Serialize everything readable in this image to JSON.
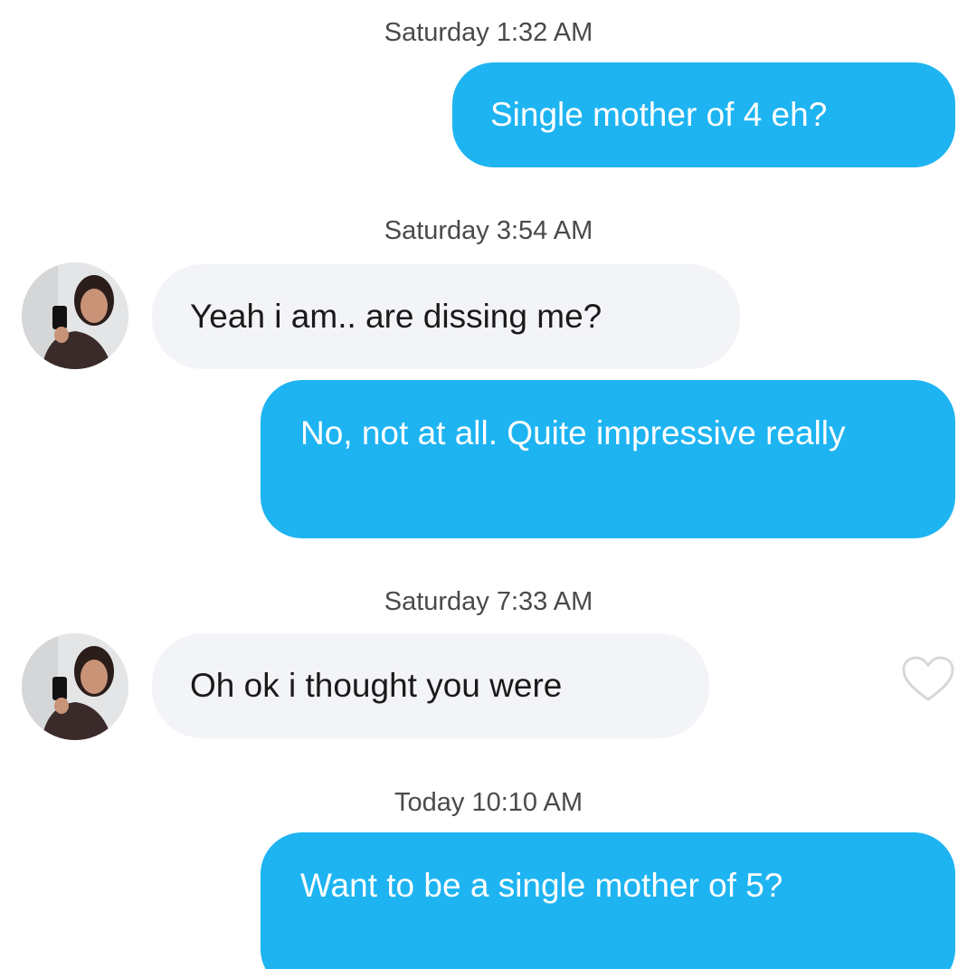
{
  "conversation": {
    "messages": [
      {
        "type": "timestamp",
        "text": "Saturday 1:32 AM"
      },
      {
        "type": "sent",
        "text": "Single mother of 4 eh?"
      },
      {
        "type": "timestamp",
        "text": "Saturday 3:54 AM"
      },
      {
        "type": "received",
        "text": "Yeah i am.. are dissing me?"
      },
      {
        "type": "sent",
        "text": "No, not at all. Quite impressive really"
      },
      {
        "type": "timestamp",
        "text": "Saturday 7:33 AM"
      },
      {
        "type": "received",
        "text": "Oh ok i thought you were",
        "liked": false
      },
      {
        "type": "timestamp",
        "text": "Today 10:10 AM"
      },
      {
        "type": "sent",
        "text": "Want to be a single mother of 5?"
      }
    ]
  },
  "icons": {
    "like": "heart-outline-icon",
    "avatar": "contact-avatar"
  },
  "colors": {
    "sent_bubble": "#1eb4f2",
    "received_bubble": "#f3f4f7",
    "timestamp_text": "#4a4a4a",
    "heart_outline": "#d8d8d8"
  }
}
